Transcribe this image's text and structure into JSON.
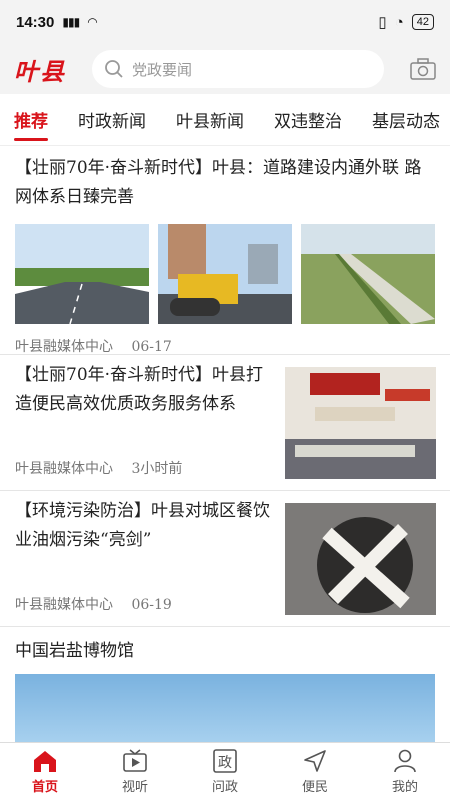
{
  "status_bar": {
    "time": "14:30",
    "signal": "46 46",
    "battery": "42"
  },
  "header": {
    "logo": "叶县",
    "search_placeholder": "党政要闻"
  },
  "tabs": [
    "推荐",
    "时政新闻",
    "叶县新闻",
    "双违整治",
    "基层动态"
  ],
  "articles": [
    {
      "title": "【壮丽70年·奋斗新时代】叶县：道路建设内通外联 路网体系日臻完善",
      "source": "叶县融媒体中心",
      "time": "06-17"
    },
    {
      "title": "【壮丽70年·奋斗新时代】叶县打造便民高效优质政务服务体系",
      "source": "叶县融媒体中心",
      "time": "3小时前"
    },
    {
      "title": "【环境污染防治】叶县对城区餐饮业油烟污染“亮剑”",
      "source": "叶县融媒体中心",
      "time": "06-19"
    },
    {
      "title": "中国岩盐博物馆"
    }
  ],
  "bottom_nav": [
    {
      "label": "首页",
      "icon": "home-icon"
    },
    {
      "label": "视听",
      "icon": "tv-icon"
    },
    {
      "label": "问政",
      "icon": "govern-icon",
      "glyph": "政"
    },
    {
      "label": "便民",
      "icon": "send-icon"
    },
    {
      "label": "我的",
      "icon": "user-icon"
    }
  ],
  "colors": {
    "accent": "#d9141b"
  }
}
